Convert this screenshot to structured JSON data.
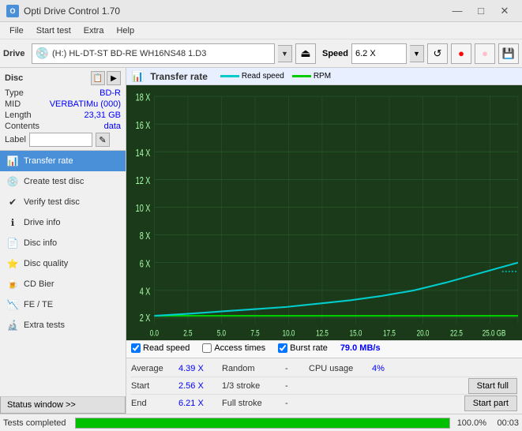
{
  "titlebar": {
    "title": "Opti Drive Control 1.70",
    "min_btn": "—",
    "max_btn": "□",
    "close_btn": "✕"
  },
  "menubar": {
    "items": [
      "File",
      "Start test",
      "Extra",
      "Help"
    ]
  },
  "toolbar": {
    "drive_label": "Drive",
    "drive_text": "(H:)  HL-DT-ST BD-RE  WH16NS48 1.D3",
    "speed_label": "Speed",
    "speed_text": "6.2 X"
  },
  "disc": {
    "section_label": "Disc",
    "type_label": "Type",
    "type_value": "BD-R",
    "mid_label": "MID",
    "mid_value": "VERBATIMu (000)",
    "length_label": "Length",
    "length_value": "23,31 GB",
    "contents_label": "Contents",
    "contents_value": "data",
    "label_label": "Label",
    "label_value": ""
  },
  "nav": {
    "items": [
      {
        "id": "transfer-rate",
        "label": "Transfer rate",
        "icon": "📊",
        "active": true
      },
      {
        "id": "create-test-disc",
        "label": "Create test disc",
        "icon": "💿",
        "active": false
      },
      {
        "id": "verify-test-disc",
        "label": "Verify test disc",
        "icon": "✔",
        "active": false
      },
      {
        "id": "drive-info",
        "label": "Drive info",
        "icon": "ℹ",
        "active": false
      },
      {
        "id": "disc-info",
        "label": "Disc info",
        "icon": "📄",
        "active": false
      },
      {
        "id": "disc-quality",
        "label": "Disc quality",
        "icon": "⭐",
        "active": false
      },
      {
        "id": "cd-bier",
        "label": "CD Bier",
        "icon": "🍺",
        "active": false
      },
      {
        "id": "fe-te",
        "label": "FE / TE",
        "icon": "📉",
        "active": false
      },
      {
        "id": "extra-tests",
        "label": "Extra tests",
        "icon": "🔬",
        "active": false
      }
    ]
  },
  "status_window": {
    "label": "Status window >>",
    "completed": "Tests completed"
  },
  "chart": {
    "title": "Transfer rate",
    "legend": [
      {
        "label": "Read speed",
        "color": "#00cccc"
      },
      {
        "label": "RPM",
        "color": "#00cc00"
      }
    ],
    "y_axis": [
      "18 X",
      "16 X",
      "14 X",
      "12 X",
      "10 X",
      "8 X",
      "6 X",
      "4 X",
      "2 X"
    ],
    "x_axis": [
      "0.0",
      "2.5",
      "5.0",
      "7.5",
      "10.0",
      "12.5",
      "15.0",
      "17.5",
      "20.0",
      "22.5",
      "25.0 GB"
    ]
  },
  "checkboxes": {
    "read_speed_label": "Read speed",
    "read_speed_checked": true,
    "access_times_label": "Access times",
    "access_times_checked": false,
    "burst_rate_label": "Burst rate",
    "burst_rate_checked": true,
    "burst_rate_value": "79.0 MB/s"
  },
  "stats": {
    "average_label": "Average",
    "average_value": "4.39 X",
    "random_label": "Random",
    "random_value": "-",
    "cpu_label": "CPU usage",
    "cpu_value": "4%",
    "start_label": "Start",
    "start_value": "2.56 X",
    "stroke13_label": "1/3 stroke",
    "stroke13_value": "-",
    "start_full_btn": "Start full",
    "end_label": "End",
    "end_value": "6.21 X",
    "full_stroke_label": "Full stroke",
    "full_stroke_value": "-",
    "start_part_btn": "Start part"
  },
  "progress": {
    "status": "Tests completed",
    "percent": "100.0%",
    "time": "00:03"
  }
}
